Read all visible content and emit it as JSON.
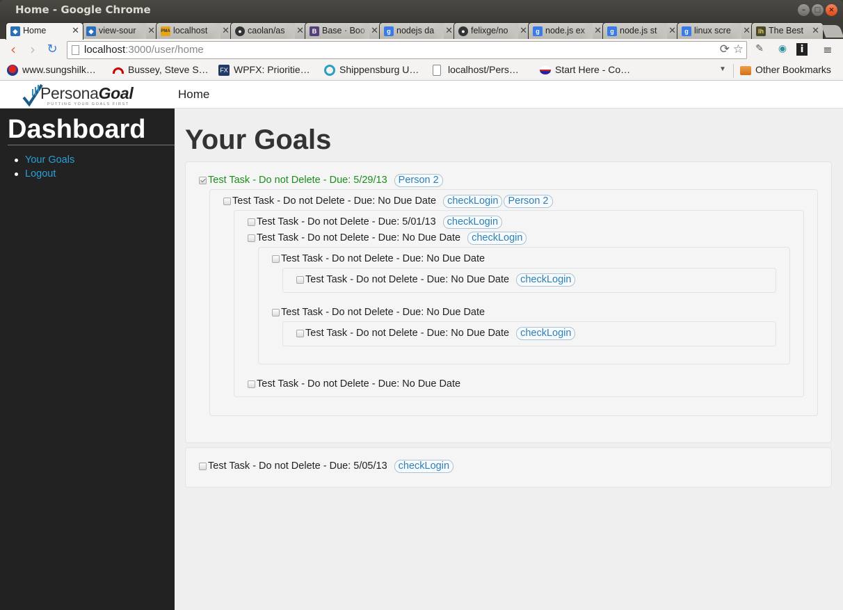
{
  "window": {
    "title": "Home - Google Chrome"
  },
  "tabs": [
    {
      "label": "Home",
      "icon": "vscode-icon"
    },
    {
      "label": "view-sour",
      "icon": "vscode-icon"
    },
    {
      "label": "localhost",
      "icon": "pma-icon"
    },
    {
      "label": "caolan/as",
      "icon": "github-icon"
    },
    {
      "label": "Base · Boo",
      "icon": "bootstrap-icon"
    },
    {
      "label": "nodejs da",
      "icon": "google-icon"
    },
    {
      "label": "felixge/no",
      "icon": "github-icon"
    },
    {
      "label": "node.js ex",
      "icon": "google-icon"
    },
    {
      "label": "node.js st",
      "icon": "google-icon"
    },
    {
      "label": "linux scre",
      "icon": "google-icon"
    },
    {
      "label": "The Best",
      "icon": "lh-icon"
    }
  ],
  "toolbar": {
    "url_host": "localhost",
    "url_path": ":3000/user/home"
  },
  "bookmarks": [
    {
      "label": "www.sungshilk…"
    },
    {
      "label": "Bussey, Steve S…"
    },
    {
      "label": "WPFX: Prioritie…"
    },
    {
      "label": "Shippensburg U…"
    },
    {
      "label": "localhost/Pers…"
    },
    {
      "label": "Start Here - Co…"
    }
  ],
  "other_bookmarks": "Other Bookmarks",
  "app": {
    "brand_persona": "Persona",
    "brand_goal": "Goal",
    "brand_tagline": "PUTTING YOUR GOALS FIRST",
    "nav_home": "Home"
  },
  "sidebar": {
    "title": "Dashboard",
    "links": [
      "Your Goals",
      "Logout"
    ]
  },
  "main": {
    "title": "Your Goals",
    "tasks": [
      {
        "text": "Test Task - Do not Delete - Due: 5/29/13",
        "checked": true,
        "tags": [
          "Person 2"
        ]
      },
      {
        "text": "Test Task - Do not Delete - Due: No Due Date",
        "checked": false,
        "tags": [
          "checkLogin",
          "Person 2"
        ]
      },
      {
        "text": "Test Task - Do not Delete - Due: 5/01/13",
        "checked": false,
        "tags": [
          "checkLogin"
        ]
      },
      {
        "text": "Test Task - Do not Delete - Due: No Due Date",
        "checked": false,
        "tags": [
          "checkLogin"
        ]
      },
      {
        "text": "Test Task - Do not Delete - Due: No Due Date",
        "checked": false,
        "tags": []
      },
      {
        "text": "Test Task - Do not Delete - Due: No Due Date",
        "checked": false,
        "tags": [
          "checkLogin"
        ]
      },
      {
        "text": "Test Task - Do not Delete - Due: No Due Date",
        "checked": false,
        "tags": []
      },
      {
        "text": "Test Task - Do not Delete - Due: No Due Date",
        "checked": false,
        "tags": [
          "checkLogin"
        ]
      },
      {
        "text": "Test Task - Do not Delete - Due: No Due Date",
        "checked": false,
        "tags": []
      },
      {
        "text": "Test Task - Do not Delete - Due: 5/05/13",
        "checked": false,
        "tags": [
          "checkLogin"
        ]
      }
    ]
  },
  "colors": {
    "link": "#2a9fd6",
    "done": "#1a8f1a",
    "sidebar_bg": "#222222",
    "page_bg": "#efefef"
  }
}
